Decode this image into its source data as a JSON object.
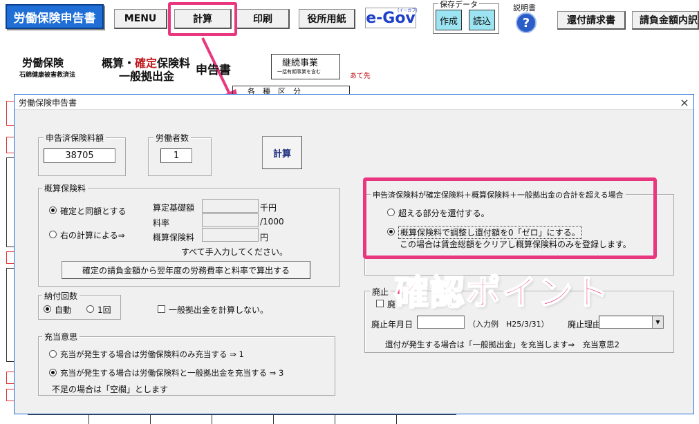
{
  "toolbar": {
    "app_title": "労働保険申告書",
    "menu": "MENU",
    "calc": "計算",
    "print": "印刷",
    "office_paper": "役所用紙",
    "egov": "e-Gov",
    "egov_sub": "(イーガブ)",
    "save_data_label": "保存データ",
    "create": "作成",
    "read": "読込",
    "manual_label": "説明書",
    "help_icon_text": "?",
    "refund_request": "還付請求書",
    "contract_detail": "請負金額内訳"
  },
  "background_form": {
    "title_left": "労働保険",
    "title_left_sub": "石綿健康被害救済法",
    "title_mid_a": "概算・",
    "title_mid_b": "確定",
    "title_mid_c": "保険料",
    "title_mid_line2": "一般拠出金",
    "title_right": "申告書",
    "business_type": "継続事業",
    "business_type_sub": "一括有期事業を含む",
    "addressee": "あて先",
    "categories_header": "各　種　区　分"
  },
  "dialog": {
    "title": "労働保険申告書",
    "close_icon": "×",
    "declared_premium_label": "申告済保険料額",
    "declared_premium_value": "38705",
    "workers_label": "労働者数",
    "workers_value": "1",
    "calc_button": "計算",
    "estimated": {
      "label": "概算保険料",
      "opt_same": "確定と同額とする",
      "opt_right": "右の計算による⇒",
      "base_label": "算定基礎額",
      "base_unit": "千円",
      "rate_label": "料率",
      "rate_unit": "/1000",
      "premium_label": "概算保険料",
      "premium_unit": "円",
      "manual_note": "すべて手入力してください。",
      "calc_from_contract": "確定の請負金額から翌年度の労務費率と料率で算出する"
    },
    "payment": {
      "label": "納付回数",
      "auto": "自動",
      "once": "1回"
    },
    "no_general_contribution": "一般拠出金を計算しない。",
    "allocation": {
      "label": "充当意思",
      "opt1": "充当が発生する場合は労働保険料のみ充当する ⇒ 1",
      "opt3": "充当が発生する場合は労働保険料と一般拠出金を充当する ⇒ 3",
      "note": "不足の場合は「空欄」とします"
    },
    "excess": {
      "label": "申告済保険料が確定保険料＋概算保険料＋一般拠出金の合計を超える場合",
      "opt_refund": "超える部分を還付する。",
      "opt_adjust": "概算保険料で調整し還付額を0「ゼロ」にする。",
      "adjust_note": "この場合は賃金総額をクリアし概算保険料のみを登録します。"
    },
    "abolition": {
      "label": "廃止",
      "checkbox_label": "廃",
      "date_label": "廃止年月日",
      "date_example": "（入力例　H25/3/31）",
      "reason_label": "廃止理由",
      "refund_note": "還付が発生する場合は「一般拠出金」を充当します⇒　充当意思2"
    }
  },
  "annotation": {
    "caption": "確認ポイント",
    "color": "#e8377f"
  }
}
